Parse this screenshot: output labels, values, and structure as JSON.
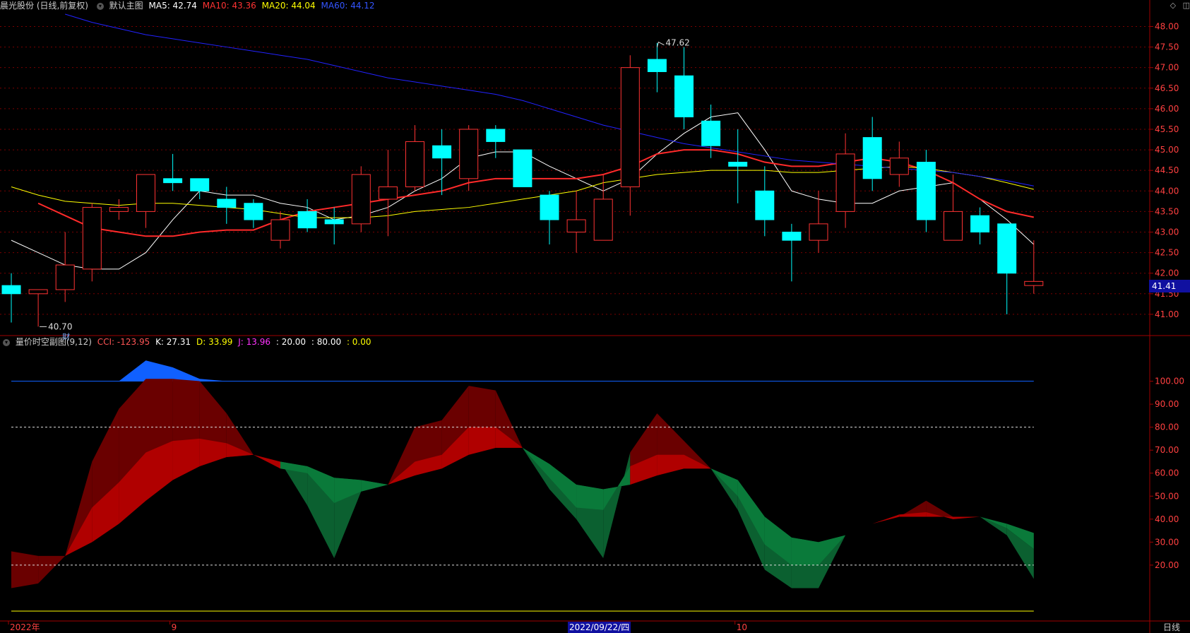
{
  "header": {
    "stock_name": "晨光股份 (日线,前复权)",
    "chart_label": "默认主图",
    "ma_items": [
      {
        "label": "MA5: 42.74",
        "color": "#ffffff"
      },
      {
        "label": "MA10: 43.36",
        "color": "#ff3333"
      },
      {
        "label": "MA20: 44.04",
        "color": "#ffff00"
      },
      {
        "label": "MA60: 44.12",
        "color": "#3333ff"
      }
    ],
    "top_icons": [
      "◇",
      "◫"
    ]
  },
  "sub_header": {
    "indicator_name": "量价时空副图(9,12)",
    "items": [
      {
        "label": "CCI: -123.95",
        "color": "#ff5555"
      },
      {
        "label": "K: 27.31",
        "color": "#ffffff"
      },
      {
        "label": "D: 33.99",
        "color": "#ffff00"
      },
      {
        "label": "J: 13.96",
        "color": "#ff33ff"
      },
      {
        "label": ": 20.00",
        "color": "#ffffff"
      },
      {
        "label": ": 80.00",
        "color": "#ffffff"
      },
      {
        "label": ": 0.00",
        "color": "#ffff00"
      }
    ]
  },
  "annotations": {
    "high_label": "47.62",
    "low_label": "40.70",
    "fin_marker": "财",
    "current_price": "41.41"
  },
  "x_axis_labels": [
    {
      "text": "2022年",
      "index": 0
    },
    {
      "text": "9",
      "index": 6
    },
    {
      "text": "10",
      "index": 27
    }
  ],
  "date_marker": "2022/09/22/四",
  "period_label": "日线",
  "colors": {
    "up": "#ff3333",
    "down": "#00ffff",
    "ma5": "#ffffff",
    "ma10": "#ff2a2a",
    "ma20": "#ffff00",
    "ma60": "#2222ff",
    "grid": "#a00000"
  },
  "chart_data": [
    {
      "type": "candlestick",
      "title": "晨光股份 (日线,前复权)",
      "y_ticks": [
        41.0,
        41.5,
        42.0,
        42.5,
        43.0,
        43.5,
        44.0,
        44.5,
        45.0,
        45.5,
        46.0,
        46.5,
        47.0,
        47.5,
        48.0
      ],
      "ylim": [
        40.5,
        48.3
      ],
      "candles": [
        {
          "o": 41.7,
          "h": 42.0,
          "l": 40.8,
          "c": 41.5
        },
        {
          "o": 41.5,
          "h": 41.6,
          "l": 40.7,
          "c": 41.6
        },
        {
          "o": 41.6,
          "h": 43.0,
          "l": 41.3,
          "c": 42.2
        },
        {
          "o": 42.1,
          "h": 43.7,
          "l": 41.8,
          "c": 43.6
        },
        {
          "o": 43.5,
          "h": 43.8,
          "l": 43.3,
          "c": 43.6
        },
        {
          "o": 43.5,
          "h": 44.3,
          "l": 43.1,
          "c": 44.4
        },
        {
          "o": 44.3,
          "h": 44.9,
          "l": 44.0,
          "c": 44.2
        },
        {
          "o": 44.3,
          "h": 44.3,
          "l": 43.8,
          "c": 44.0
        },
        {
          "o": 43.8,
          "h": 44.1,
          "l": 43.2,
          "c": 43.6
        },
        {
          "o": 43.7,
          "h": 43.8,
          "l": 43.1,
          "c": 43.3
        },
        {
          "o": 42.8,
          "h": 43.5,
          "l": 42.6,
          "c": 43.3
        },
        {
          "o": 43.5,
          "h": 43.8,
          "l": 43.0,
          "c": 43.1
        },
        {
          "o": 43.3,
          "h": 43.6,
          "l": 42.7,
          "c": 43.2
        },
        {
          "o": 43.2,
          "h": 44.6,
          "l": 43.0,
          "c": 44.4
        },
        {
          "o": 43.8,
          "h": 45.0,
          "l": 42.9,
          "c": 44.1
        },
        {
          "o": 44.1,
          "h": 45.6,
          "l": 44.0,
          "c": 45.2
        },
        {
          "o": 45.1,
          "h": 45.5,
          "l": 43.9,
          "c": 44.8
        },
        {
          "o": 44.3,
          "h": 45.6,
          "l": 44.0,
          "c": 45.5
        },
        {
          "o": 45.5,
          "h": 45.6,
          "l": 44.8,
          "c": 45.2
        },
        {
          "o": 45.0,
          "h": 45.0,
          "l": 44.1,
          "c": 44.1
        },
        {
          "o": 43.9,
          "h": 44.0,
          "l": 42.7,
          "c": 43.3
        },
        {
          "o": 43.0,
          "h": 44.0,
          "l": 42.5,
          "c": 43.3
        },
        {
          "o": 42.8,
          "h": 44.4,
          "l": 42.8,
          "c": 43.8
        },
        {
          "o": 44.1,
          "h": 47.3,
          "l": 43.4,
          "c": 47.0
        },
        {
          "o": 47.2,
          "h": 47.6,
          "l": 46.4,
          "c": 46.9
        },
        {
          "o": 46.8,
          "h": 47.5,
          "l": 45.5,
          "c": 45.8
        },
        {
          "o": 45.7,
          "h": 46.1,
          "l": 44.8,
          "c": 45.1
        },
        {
          "o": 44.7,
          "h": 45.5,
          "l": 43.7,
          "c": 44.6
        },
        {
          "o": 44.0,
          "h": 44.6,
          "l": 42.9,
          "c": 43.3
        },
        {
          "o": 43.0,
          "h": 43.2,
          "l": 41.8,
          "c": 42.8
        },
        {
          "o": 42.8,
          "h": 44.0,
          "l": 42.5,
          "c": 43.2
        },
        {
          "o": 43.5,
          "h": 45.4,
          "l": 43.1,
          "c": 44.9
        },
        {
          "o": 45.3,
          "h": 45.8,
          "l": 44.0,
          "c": 44.3
        },
        {
          "o": 44.4,
          "h": 45.2,
          "l": 44.1,
          "c": 44.8
        },
        {
          "o": 44.7,
          "h": 45.0,
          "l": 43.0,
          "c": 43.3
        },
        {
          "o": 42.8,
          "h": 44.4,
          "l": 42.8,
          "c": 43.5
        },
        {
          "o": 43.4,
          "h": 43.6,
          "l": 42.7,
          "c": 43.0
        },
        {
          "o": 43.2,
          "h": 43.2,
          "l": 41.0,
          "c": 42.0
        },
        {
          "o": 41.7,
          "h": 42.8,
          "l": 41.5,
          "c": 41.8
        }
      ],
      "series": [
        {
          "name": "MA5",
          "values": [
            42.8,
            42.5,
            42.2,
            42.1,
            42.1,
            42.5,
            43.3,
            44.0,
            43.9,
            43.9,
            43.7,
            43.6,
            43.3,
            43.4,
            43.6,
            44.0,
            44.3,
            44.8,
            44.95,
            44.95,
            44.6,
            44.3,
            44.0,
            44.3,
            44.9,
            45.4,
            45.8,
            45.9,
            45.0,
            44.0,
            43.8,
            43.7,
            43.7,
            44.0,
            44.1,
            44.2,
            43.8,
            43.3,
            42.7
          ]
        },
        {
          "name": "MA10",
          "values": [
            43.7,
            43.4,
            43.1,
            43.0,
            42.9,
            42.9,
            43.0,
            43.05,
            43.05,
            43.3,
            43.5,
            43.6,
            43.7,
            43.8,
            43.9,
            44.0,
            44.2,
            44.3,
            44.3,
            44.3,
            44.3,
            44.4,
            44.6,
            44.9,
            45.0,
            45.0,
            44.9,
            44.7,
            44.6,
            44.6,
            44.7,
            44.8,
            44.7,
            44.5,
            44.2,
            43.8,
            43.5,
            43.36
          ]
        },
        {
          "name": "MA20",
          "values": [
            44.1,
            43.9,
            43.75,
            43.7,
            43.65,
            43.7,
            43.7,
            43.65,
            43.6,
            43.55,
            43.45,
            43.35,
            43.35,
            43.35,
            43.4,
            43.5,
            43.55,
            43.6,
            43.7,
            43.8,
            43.9,
            44.0,
            44.2,
            44.3,
            44.4,
            44.45,
            44.5,
            44.5,
            44.5,
            44.45,
            44.45,
            44.5,
            44.55,
            44.6,
            44.55,
            44.45,
            44.35,
            44.2,
            44.04
          ]
        },
        {
          "name": "MA60",
          "values": [
            48.3,
            48.1,
            47.95,
            47.8,
            47.7,
            47.6,
            47.5,
            47.4,
            47.3,
            47.2,
            47.05,
            46.9,
            46.75,
            46.65,
            46.55,
            46.45,
            46.35,
            46.2,
            46.0,
            45.8,
            45.6,
            45.45,
            45.3,
            45.15,
            45.05,
            44.95,
            44.85,
            44.75,
            44.7,
            44.65,
            44.6,
            44.55,
            44.5,
            44.45,
            44.35,
            44.25,
            44.12
          ]
        }
      ]
    },
    {
      "type": "area",
      "title": "量价时空副图(9,12)",
      "y_ticks": [
        20.0,
        30.0,
        40.0,
        50.0,
        60.0,
        70.0,
        80.0,
        90.0,
        100.0
      ],
      "ylim": [
        -4,
        114
      ],
      "reference_lines": [
        20,
        80,
        100
      ],
      "series": [
        {
          "name": "K",
          "values": [
            26,
            24,
            24,
            65,
            88,
            101,
            101,
            100,
            86,
            68,
            65,
            46,
            23,
            52,
            55,
            80,
            83,
            98,
            96,
            71,
            53,
            40,
            23,
            69,
            86,
            74,
            62,
            44,
            18,
            10,
            10,
            33,
            38,
            41,
            48,
            41,
            41,
            33,
            14
          ]
        },
        {
          "name": "D",
          "values": [
            10,
            12,
            24,
            30,
            38,
            48,
            57,
            63,
            67,
            68,
            65,
            63,
            58,
            57,
            55,
            59,
            62,
            68,
            71,
            71,
            64,
            55,
            53,
            55,
            59,
            62,
            62,
            57,
            41,
            32,
            30,
            33,
            38,
            41,
            41,
            41,
            41,
            36,
            27
          ]
        },
        {
          "name": "J",
          "values": [
            10,
            12,
            24,
            45,
            56,
            69,
            74,
            75,
            73,
            68,
            62,
            60,
            47,
            52,
            55,
            65,
            68,
            80,
            80,
            71,
            58,
            45,
            44,
            63,
            68,
            68,
            62,
            50,
            29,
            20,
            20,
            33,
            38,
            42,
            43,
            40,
            41,
            38,
            34
          ]
        },
        {
          "name": "upper",
          "values": [
            100,
            100,
            100,
            100,
            100,
            100,
            100,
            100,
            100,
            100,
            100,
            100,
            100,
            100,
            100,
            100,
            100,
            100,
            100,
            100,
            100,
            100,
            100,
            100,
            100,
            100,
            100,
            100,
            100,
            100,
            100,
            100,
            100,
            100,
            100,
            100,
            100,
            100,
            100
          ]
        },
        {
          "name": "blue_peak",
          "values": [
            100,
            100,
            100,
            100,
            100,
            109,
            106,
            101,
            100,
            100,
            100,
            100,
            100,
            100,
            100,
            100,
            100,
            100,
            100,
            100,
            100,
            100,
            100,
            100,
            100,
            100,
            100,
            100,
            100,
            100,
            100,
            100,
            100,
            100,
            100,
            100,
            100,
            100,
            100
          ]
        }
      ]
    }
  ]
}
